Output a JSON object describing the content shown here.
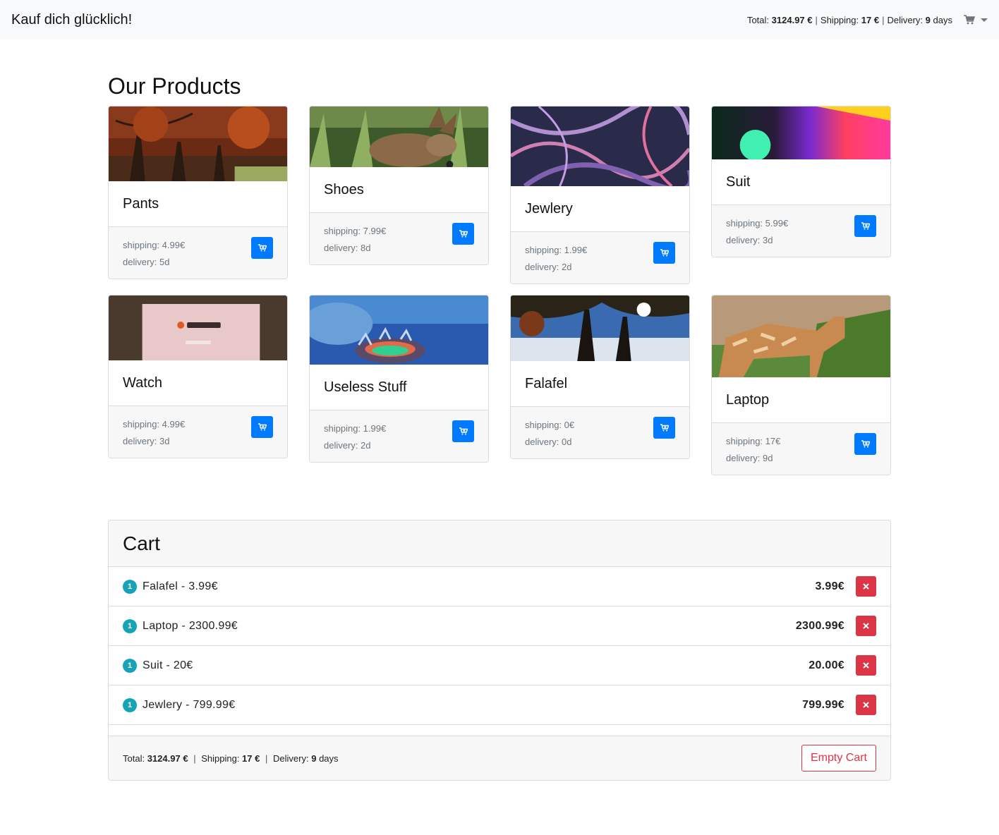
{
  "navbar": {
    "brand": "Kauf dich glücklich!",
    "total_label": "Total:",
    "total_value": "3124.97",
    "total_unit": "€",
    "shipping_label": "Shipping:",
    "shipping_value": "17",
    "shipping_unit": "€",
    "delivery_label": "Delivery:",
    "delivery_value": "9",
    "delivery_unit": "days"
  },
  "products_heading": "Our Products",
  "products": [
    {
      "name": "Pants",
      "shipping": "shipping: 4.99€",
      "delivery": "delivery: 5d"
    },
    {
      "name": "Shoes",
      "shipping": "shipping: 7.99€",
      "delivery": "delivery: 8d"
    },
    {
      "name": "Jewlery",
      "shipping": "shipping: 1.99€",
      "delivery": "delivery: 2d"
    },
    {
      "name": "Suit",
      "shipping": "shipping: 5.99€",
      "delivery": "delivery: 3d"
    },
    {
      "name": "Watch",
      "shipping": "shipping: 4.99€",
      "delivery": "delivery: 3d"
    },
    {
      "name": "Useless Stuff",
      "shipping": "shipping: 1.99€",
      "delivery": "delivery: 2d"
    },
    {
      "name": "Falafel",
      "shipping": "shipping: 0€",
      "delivery": "delivery: 0d"
    },
    {
      "name": "Laptop",
      "shipping": "shipping: 17€",
      "delivery": "delivery: 9d"
    }
  ],
  "cart": {
    "title": "Cart",
    "items": [
      {
        "qty": "1",
        "label": "Falafel - 3.99€",
        "price": "3.99€"
      },
      {
        "qty": "1",
        "label": "Laptop - 2300.99€",
        "price": "2300.99€"
      },
      {
        "qty": "1",
        "label": "Suit - 20€",
        "price": "20.00€"
      },
      {
        "qty": "1",
        "label": "Jewlery - 799.99€",
        "price": "799.99€"
      }
    ],
    "footer": {
      "total_label": "Total:",
      "total_value": "3124.97",
      "total_unit": "€",
      "shipping_label": "Shipping:",
      "shipping_value": "17",
      "shipping_unit": "€",
      "delivery_label": "Delivery:",
      "delivery_value": "9",
      "delivery_unit": "days"
    },
    "empty_label": "Empty Cart"
  },
  "icons": {
    "cart": "shopping-cart-icon",
    "add": "cart-plus-icon",
    "remove": "times-icon"
  },
  "colors": {
    "primary": "#007bff",
    "danger": "#dc3545",
    "info": "#17a2b8",
    "navbar_bg": "#f8f9fa"
  }
}
